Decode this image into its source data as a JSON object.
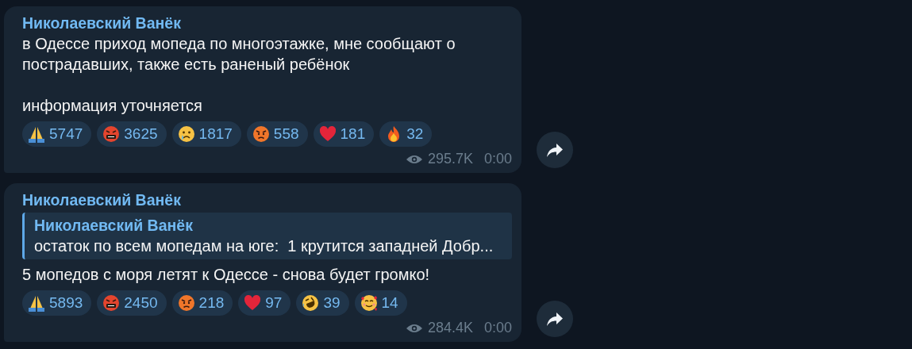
{
  "messages": [
    {
      "author": "Николаевский Ванёк",
      "text": [
        "в Одессе приход мопеда по многоэтажке, мне сообщают о пострадавших, также есть раненый ребёнок",
        "информация уточняется"
      ],
      "reactions": [
        {
          "kind": "pray",
          "count": "5747"
        },
        {
          "kind": "cursing",
          "count": "3625"
        },
        {
          "kind": "crying",
          "count": "1817"
        },
        {
          "kind": "angry",
          "count": "558"
        },
        {
          "kind": "heart",
          "count": "181"
        },
        {
          "kind": "fire",
          "count": "32"
        }
      ],
      "views": "295.7K",
      "time": "0:00"
    },
    {
      "author": "Николаевский Ванёк",
      "reply": {
        "author": "Николаевский Ванёк",
        "text": "остаток по всем мопедам на юге:  1 крутится западней Добр..."
      },
      "text": [
        "5 мопедов с моря летят к Одессе - снова будет громко!"
      ],
      "reactions": [
        {
          "kind": "pray",
          "count": "5893"
        },
        {
          "kind": "cursing",
          "count": "2450"
        },
        {
          "kind": "angry",
          "count": "218"
        },
        {
          "kind": "heart",
          "count": "97"
        },
        {
          "kind": "rofl",
          "count": "39"
        },
        {
          "kind": "hearts",
          "count": "14"
        }
      ],
      "views": "284.4K",
      "time": "0:00"
    }
  ]
}
